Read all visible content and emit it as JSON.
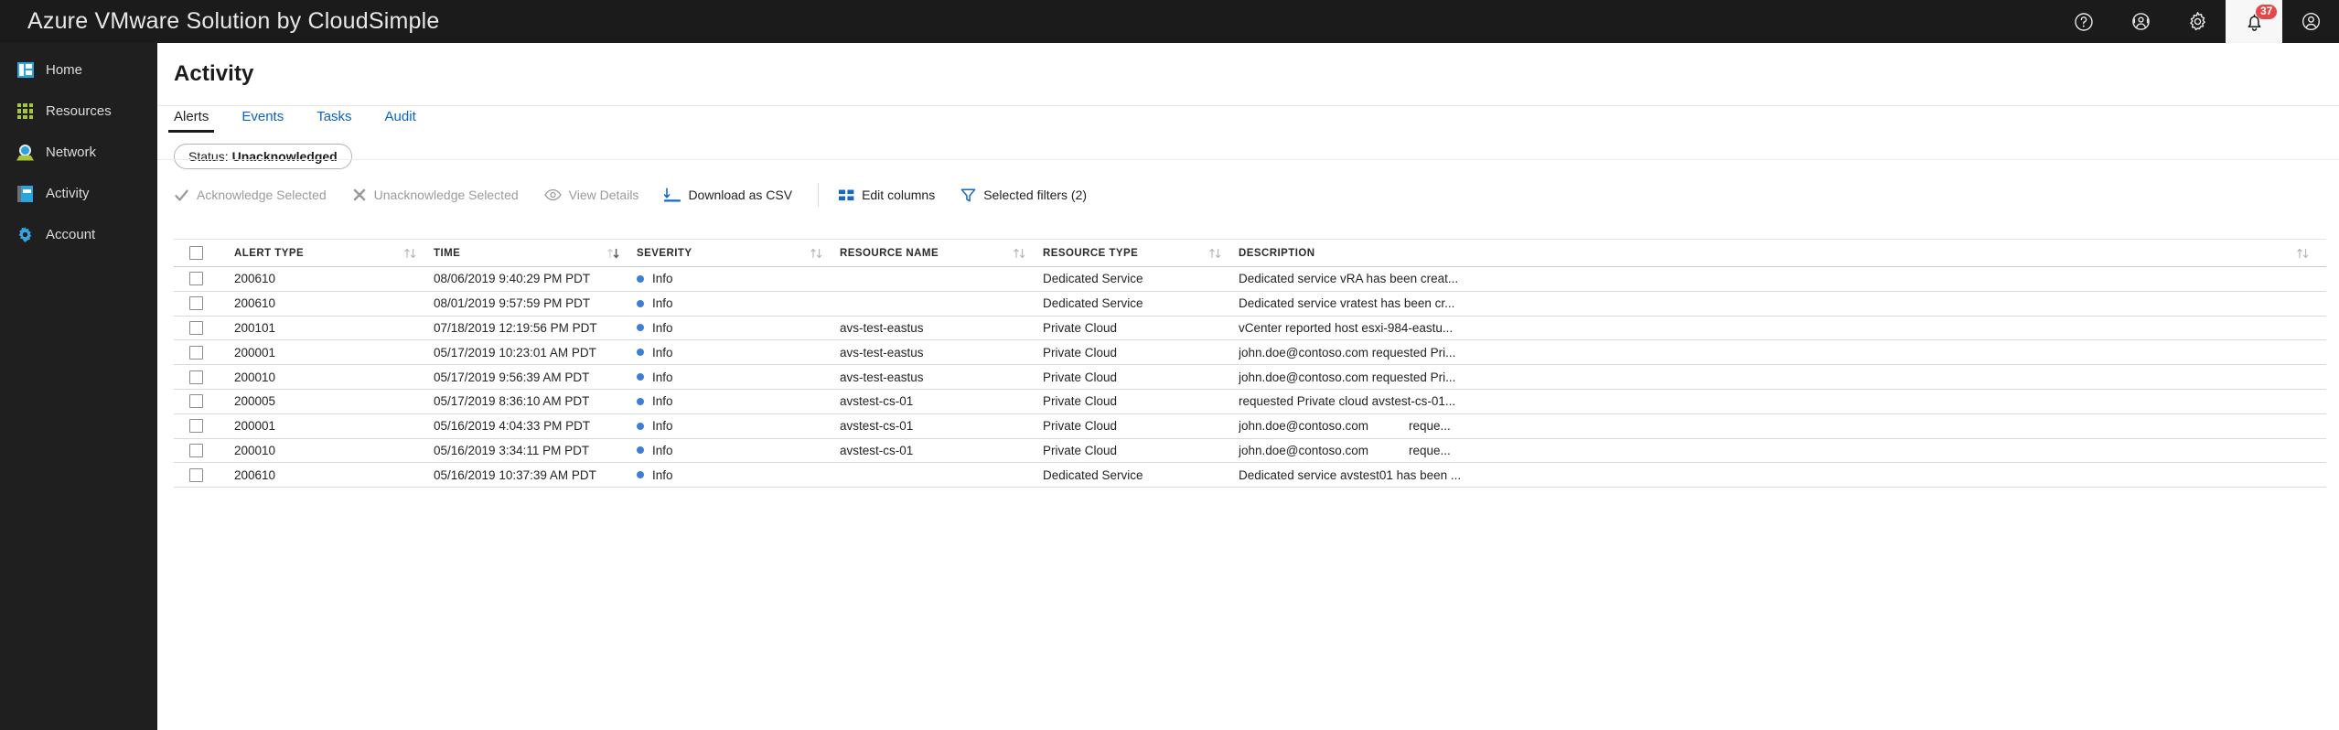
{
  "topbar": {
    "brand": "Azure VMware Solution by CloudSimple",
    "icons": [
      {
        "name": "help-icon",
        "glyph": "?"
      },
      {
        "name": "support-icon",
        "glyph": "headset"
      },
      {
        "name": "gear-icon",
        "glyph": "gear"
      },
      {
        "name": "notifications-icon",
        "glyph": "bell",
        "badge": "37"
      },
      {
        "name": "user-account-icon",
        "glyph": "person"
      }
    ]
  },
  "sidebar": {
    "items": [
      {
        "label": "Home",
        "icon": "home-icon"
      },
      {
        "label": "Resources",
        "icon": "resources-grid-icon"
      },
      {
        "label": "Network",
        "icon": "network-globe-icon"
      },
      {
        "label": "Activity",
        "icon": "activity-notebook-icon"
      },
      {
        "label": "Account",
        "icon": "account-gear-icon"
      }
    ]
  },
  "page": {
    "title": "Activity",
    "tabs": [
      {
        "label": "Alerts",
        "active": true
      },
      {
        "label": "Events",
        "active": false
      },
      {
        "label": "Tasks",
        "active": false
      },
      {
        "label": "Audit",
        "active": false
      }
    ],
    "filter_chip": {
      "label": "Status:",
      "value": "Unacknowledged"
    },
    "toolbar": [
      {
        "label": "Acknowledge Selected",
        "icon": "check-icon",
        "disabled": true
      },
      {
        "label": "Unacknowledge Selected",
        "icon": "x-icon",
        "disabled": true
      },
      {
        "label": "View Details",
        "icon": "eye-icon",
        "disabled": true
      },
      {
        "label": "Download as CSV",
        "icon": "download-icon",
        "disabled": false
      },
      {
        "label": "Edit columns",
        "icon": "columns-icon",
        "disabled": false
      },
      {
        "label": "Selected filters (2)",
        "icon": "funnel-icon",
        "disabled": false
      }
    ]
  },
  "table": {
    "columns": [
      "ALERT TYPE",
      "TIME",
      "SEVERITY",
      "RESOURCE NAME",
      "RESOURCE TYPE",
      "DESCRIPTION"
    ],
    "sorted_column": "TIME",
    "sort_direction": "desc",
    "rows": [
      {
        "alert_type": "200610",
        "time": "08/06/2019 9:40:29 PM PDT",
        "severity": "Info",
        "resource_name": "",
        "resource_type": "Dedicated Service",
        "description": "Dedicated service vRA has been creat...",
        "description_2": ""
      },
      {
        "alert_type": "200610",
        "time": "08/01/2019 9:57:59 PM PDT",
        "severity": "Info",
        "resource_name": "",
        "resource_type": "Dedicated Service",
        "description": "Dedicated service vratest has been cr...",
        "description_2": ""
      },
      {
        "alert_type": "200101",
        "time": "07/18/2019 12:19:56 PM PDT",
        "severity": "Info",
        "resource_name": "avs-test-eastus",
        "resource_type": "Private Cloud",
        "description": "vCenter reported host esxi-984-eastu...",
        "description_2": ""
      },
      {
        "alert_type": "200001",
        "time": "05/17/2019 10:23:01 AM PDT",
        "severity": "Info",
        "resource_name": "avs-test-eastus",
        "resource_type": "Private Cloud",
        "description": "john.doe@contoso.com requested Pri...",
        "description_2": ""
      },
      {
        "alert_type": "200010",
        "time": "05/17/2019 9:56:39 AM PDT",
        "severity": "Info",
        "resource_name": "avs-test-eastus",
        "resource_type": "Private Cloud",
        "description": "john.doe@contoso.com requested Pri...",
        "description_2": ""
      },
      {
        "alert_type": "200005",
        "time": "05/17/2019 8:36:10 AM PDT",
        "severity": "Info",
        "resource_name": "avstest-cs-01",
        "resource_type": "Private Cloud",
        "description": "requested Private cloud avstest-cs-01...",
        "description_2": ""
      },
      {
        "alert_type": "200001",
        "time": "05/16/2019 4:04:33 PM PDT",
        "severity": "Info",
        "resource_name": "avstest-cs-01",
        "resource_type": "Private Cloud",
        "description": "john.doe@contoso.com",
        "description_2": "reque..."
      },
      {
        "alert_type": "200010",
        "time": "05/16/2019 3:34:11 PM PDT",
        "severity": "Info",
        "resource_name": "avstest-cs-01",
        "resource_type": "Private Cloud",
        "description": "john.doe@contoso.com",
        "description_2": "reque..."
      },
      {
        "alert_type": "200610",
        "time": "05/16/2019 10:37:39 AM PDT",
        "severity": "Info",
        "resource_name": "",
        "resource_type": "Dedicated Service",
        "description": "Dedicated service avstest01 has been ...",
        "description_2": ""
      }
    ]
  },
  "colors": {
    "topbar_bg": "#1b1b1b",
    "sidebar_bg": "#1f1f1f",
    "link_blue": "#0a64c2",
    "severity_info": "#3d7fd6",
    "badge_red": "#e4484a"
  }
}
